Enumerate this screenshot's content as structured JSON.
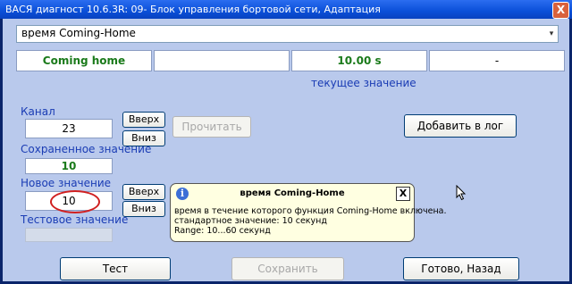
{
  "window": {
    "title": "ВАСЯ диагност 10.6.3R: 09- Блок управления бортовой сети, Адаптация",
    "close_glyph": "X"
  },
  "selector": {
    "value": "время Coming-Home",
    "arrow": "▾"
  },
  "status": {
    "name": "Coming home",
    "empty1": "",
    "value": "10.00 s",
    "dash": "-",
    "caption": "текущее значение"
  },
  "channel": {
    "label": "Канал",
    "value": "23",
    "up": "Вверх",
    "down": "Вниз"
  },
  "read_button": "Прочитать",
  "log_button": "Добавить в лог",
  "saved": {
    "label": "Сохраненное значение",
    "value": "10"
  },
  "new_value": {
    "label": "Новое значение",
    "value": "10",
    "up": "Вверх",
    "down": "Вниз"
  },
  "test_value": {
    "label": "Тестовое значение",
    "value": ""
  },
  "buttons": {
    "test": "Тест",
    "save": "Сохранить",
    "done": "Готово, Назад"
  },
  "tooltip": {
    "title": "время Coming-Home",
    "line1": "время в течение которого функция Coming-Home включена.",
    "line2": "стандартное значение: 10 секунд",
    "line3": "Range: 10...60 секунд",
    "icon": "i",
    "close": "X"
  }
}
